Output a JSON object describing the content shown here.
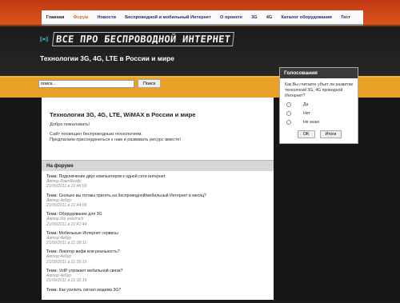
{
  "nav": {
    "items": [
      {
        "label": "Главная"
      },
      {
        "label": "Форум"
      },
      {
        "label": "Новости"
      },
      {
        "label": "Беспроводной и мобильный Интернет"
      },
      {
        "label": "О проекте"
      },
      {
        "label": "3G"
      },
      {
        "label": "4G"
      },
      {
        "label": "Каталог оборудования"
      },
      {
        "label": "Тест"
      }
    ]
  },
  "header": {
    "logo_text": "ВСЕ ПРО БЕСПРОВОДНОЙ ИНТЕРНЕТ",
    "tagline": "Технологии 3G, 4G, LTE в России и мире"
  },
  "search": {
    "value": "поиск...",
    "button_label": "Поиск"
  },
  "welcome": {
    "title": "Технологии 3G, 4G, LTE, WiMAX в России и мире",
    "line1": "Добро пожаловать!",
    "line2": "Сайт посвящен беспроводным технологиям.",
    "line3": "Предлагаем присоединиться к нам и развивать ресурс вместе!"
  },
  "forum": {
    "header": "На форуме",
    "topic_prefix": "Тема:",
    "posts": [
      {
        "title": "Подключение двух компьютеров к одной сети интернет.",
        "author": "Автор RaenReally",
        "date": "21/09/2011 в 21:46:03"
      },
      {
        "title": "Сколько вы готовы тратить на беспроводной/мобильный Интернет в месяц?",
        "author": "Автор 4eбур",
        "date": "21/09/2011 в 21:44:09"
      },
      {
        "title": "Оборудование для 3G",
        "author": "Автор the potemich",
        "date": "21/09/2011 в 21:41:44"
      },
      {
        "title": "Мобильные Интернет сервисы",
        "author": "Автор 4eбур",
        "date": "21/09/2011 в 21:38:11"
      },
      {
        "title": "Локатор вифи или реальность?",
        "author": "Автор 4eбур",
        "date": "21/09/2011 в 21:35:19"
      },
      {
        "title": "VoIP угрожает мобильной связи?",
        "author": "Автор 4eбур",
        "date": "21/09/2011 в 21:32:19"
      },
      {
        "title": "Как усилить сигнал модема 3G?",
        "author": "",
        "date": ""
      }
    ]
  },
  "poll": {
    "title": "Голосования",
    "question": "Как Вы считаете убъет ли развитие технологий 3G, 4G проводной Интернет?",
    "options": [
      {
        "label": "Да"
      },
      {
        "label": "Нет"
      },
      {
        "label": "Не знаю"
      }
    ],
    "ok_label": "OK",
    "results_label": "Итоги"
  }
}
